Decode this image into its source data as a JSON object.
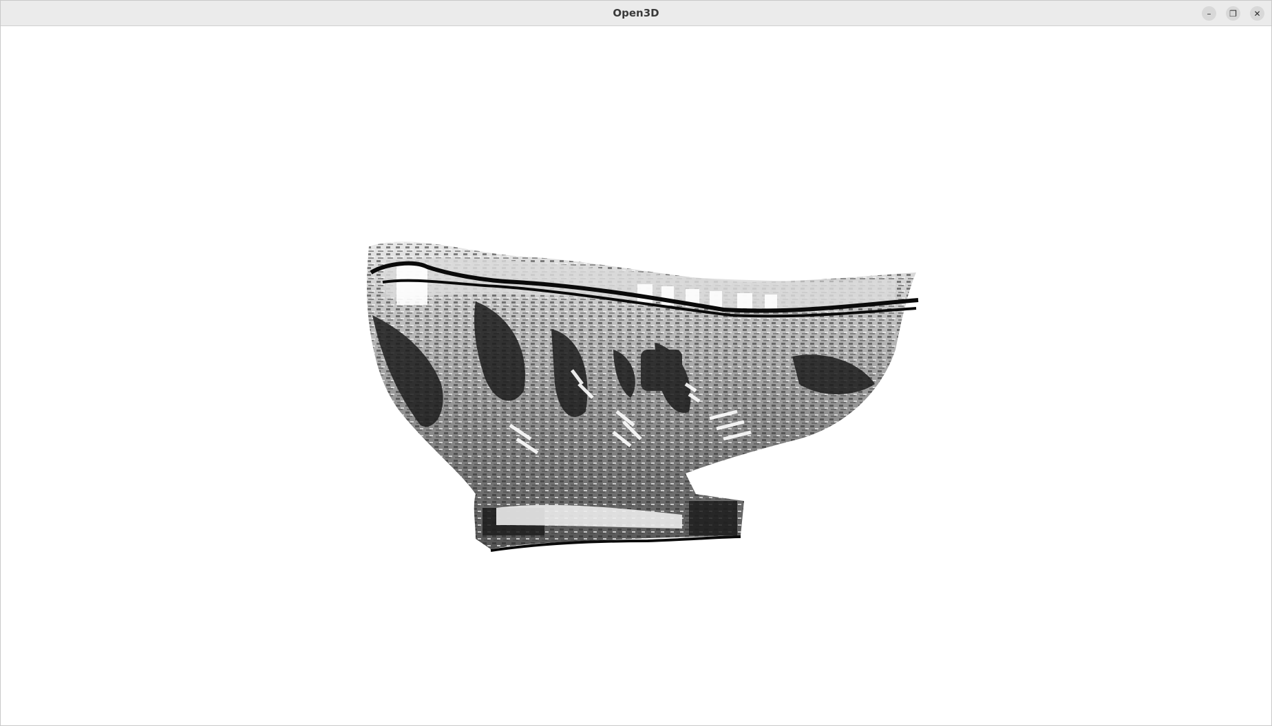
{
  "window": {
    "title": "Open3D"
  },
  "controls": {
    "minimize_icon": "minimize-icon",
    "maximize_icon": "maximize-icon",
    "close_icon": "close-icon",
    "minimize_glyph": "–",
    "maximize_glyph": "❐",
    "close_glyph": "✕"
  },
  "colors": {
    "titlebar": "#ebebeb",
    "background": "#ffffff",
    "point_cloud_dark": "#111111",
    "point_cloud_light": "#e6e6e6"
  }
}
